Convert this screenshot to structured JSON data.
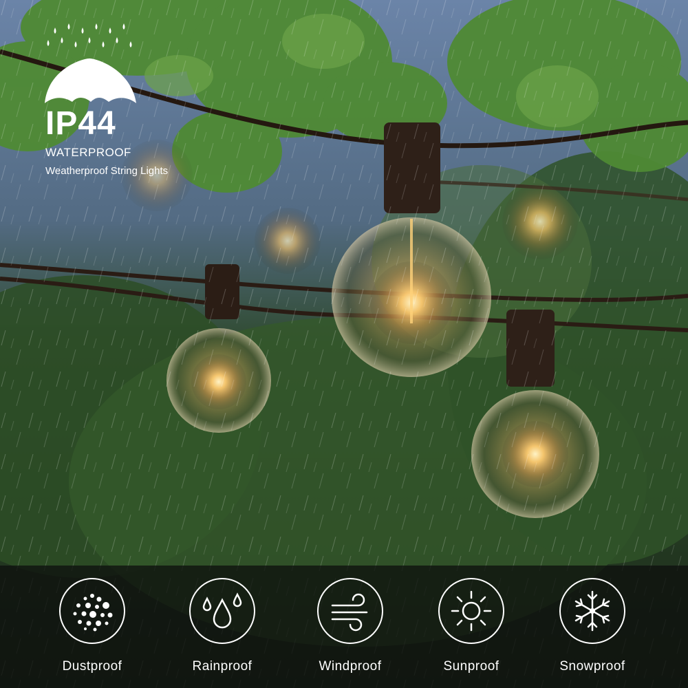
{
  "badge": {
    "icon": "umbrella-rain-icon",
    "rating": "IP44",
    "label": "WATERPROOF",
    "subtitle": "Weatherproof String Lights"
  },
  "features": [
    {
      "label": "Dustproof",
      "icon": "dust-particles-icon"
    },
    {
      "label": "Rainproof",
      "icon": "water-drops-icon"
    },
    {
      "label": "Windproof",
      "icon": "wind-icon"
    },
    {
      "label": "Sunproof",
      "icon": "sun-icon"
    },
    {
      "label": "Snowproof",
      "icon": "snowflake-icon"
    }
  ],
  "colors": {
    "foliage": "#3f6b2c",
    "bulb_glow": "#ffb347",
    "cord": "#2a1c14",
    "feature_bar": "#0e110e",
    "text": "#ffffff"
  }
}
